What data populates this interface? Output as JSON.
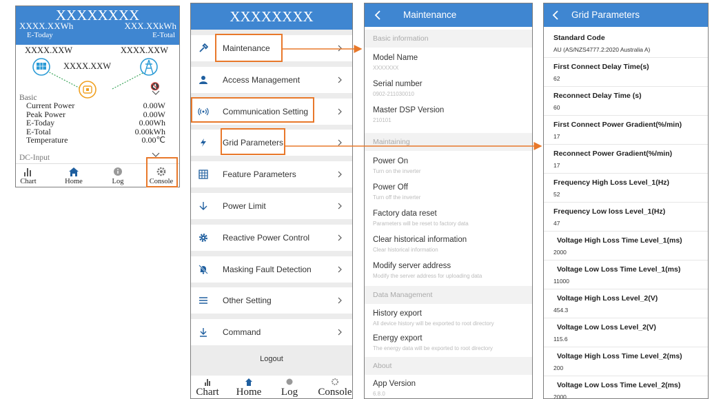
{
  "dashboard": {
    "title": "XXXXXXXX",
    "today_value": "XXXX.XXWh",
    "total_value": "XXX.XXkWh",
    "today_label": "E-Today",
    "total_label": "E-Total",
    "left_power": "XXXX.XXW",
    "right_power": "XXXX.XXW",
    "mid_power": "XXXX.XXW",
    "basic_label": "Basic",
    "rows": [
      {
        "label": "Current Power",
        "value": "0.00W"
      },
      {
        "label": "Peak Power",
        "value": "0.00W"
      },
      {
        "label": "E-Today",
        "value": "0.00Wh"
      },
      {
        "label": "E-Total",
        "value": "0.00kWh"
      },
      {
        "label": "Temperature",
        "value": "0.00℃"
      }
    ],
    "dc_input_label": "DC-Input",
    "nav": [
      "Chart",
      "Home",
      "Log",
      "Console"
    ]
  },
  "console": {
    "title": "XXXXXXXX",
    "items": [
      {
        "label": "Maintenance",
        "icon": "hammer-icon"
      },
      {
        "label": "Access Management",
        "icon": "user-icon"
      },
      {
        "label": "Communication Setting",
        "icon": "signal-icon"
      },
      {
        "label": "Grid Parameters",
        "icon": "lightning-icon"
      },
      {
        "label": "Feature Parameters",
        "icon": "grid-icon"
      },
      {
        "label": "Power Limit",
        "icon": "arrow-down-icon"
      },
      {
        "label": "Reactive Power Control",
        "icon": "gear-icon"
      },
      {
        "label": "Masking Fault Detection",
        "icon": "bell-off-icon"
      },
      {
        "label": "Other Setting",
        "icon": "menu-icon"
      },
      {
        "label": "Command",
        "icon": "download-icon"
      }
    ],
    "logout": "Logout",
    "nav": [
      "Chart",
      "Home",
      "Log",
      "Console"
    ]
  },
  "maintenance": {
    "title": "Maintenance",
    "sections": {
      "basic": "Basic information",
      "maintaining": "Maintaining",
      "data": "Data Management",
      "about": "About"
    },
    "info": [
      {
        "label": "Model Name",
        "value": "XXXXXXX"
      },
      {
        "label": "Serial number",
        "value": "0902-211030010"
      },
      {
        "label": "Master DSP Version",
        "value": "210101"
      }
    ],
    "maintaining": [
      {
        "label": "Power On",
        "desc": "Turn on the inverter"
      },
      {
        "label": "Power Off",
        "desc": "Turn off the inverter"
      },
      {
        "label": "Factory data reset",
        "desc": "Parameters will be reset to factory data"
      },
      {
        "label": "Clear historical information",
        "desc": "Clear historical information"
      },
      {
        "label": "Modify server address",
        "desc": "Modify the server address for uploading data"
      }
    ],
    "data": [
      {
        "label": "History export",
        "desc": "All device history will be exported to root directory"
      },
      {
        "label": "Energy export",
        "desc": "The energy data will be exported to root directory"
      }
    ],
    "about": [
      {
        "label": "App Version",
        "value": "6.8.0"
      }
    ]
  },
  "grid": {
    "title": "Grid Parameters",
    "params": [
      {
        "name": "Standard Code",
        "value": "AU (AS/NZS4777.2:2020 Australia A)"
      },
      {
        "name": "First Connect Delay Time(s)",
        "value": "62"
      },
      {
        "name": "Reconnect Delay Time (s)",
        "value": "60"
      },
      {
        "name": "First Connect Power Gradient(%/min)",
        "value": "17"
      },
      {
        "name": "Reconnect Power Gradient(%/min)",
        "value": "17"
      },
      {
        "name": "Frequency High Loss Level_1(Hz)",
        "value": "52"
      },
      {
        "name": "Frequency Low loss Level_1(Hz)",
        "value": "47"
      },
      {
        "name": "Voltage High Loss Time Level_1(ms)",
        "value": "2000"
      },
      {
        "name": "Voltage Low Loss Time Level_1(ms)",
        "value": "11000"
      },
      {
        "name": "Voltage High Loss Level_2(V)",
        "value": "454.3"
      },
      {
        "name": "Voltage Low Loss Level_2(V)",
        "value": "115.6"
      },
      {
        "name": "Voltage High Loss Time Level_2(ms)",
        "value": "200"
      },
      {
        "name": "Voltage Low Loss Time Level_2(ms)",
        "value": "2000"
      }
    ]
  },
  "colors": {
    "header": "#3f86d1",
    "highlight": "#e8782a",
    "accent": "#e69233"
  }
}
